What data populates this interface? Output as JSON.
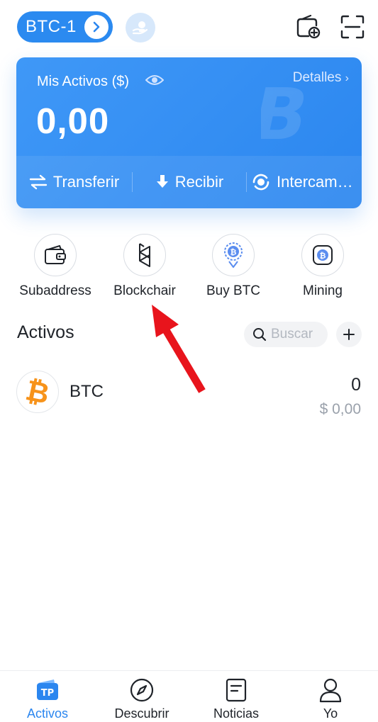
{
  "header": {
    "wallet_name": "BTC-1"
  },
  "card": {
    "label": "Mis Activos ($)",
    "details": "Detalles",
    "amount": "0,00",
    "actions": [
      {
        "label": "Transferir",
        "icon": "transfer-icon"
      },
      {
        "label": "Recibir",
        "icon": "download-icon"
      },
      {
        "label": "Intercam…",
        "icon": "swap-icon"
      }
    ]
  },
  "quick": [
    {
      "label": "Subaddress",
      "icon": "wallet-icon"
    },
    {
      "label": "Blockchair",
      "icon": "blockchair-icon"
    },
    {
      "label": "Buy BTC",
      "icon": "bitcoin-pin-icon"
    },
    {
      "label": "Mining",
      "icon": "mining-icon"
    }
  ],
  "assets": {
    "title": "Activos",
    "search_placeholder": "Buscar",
    "tokens": [
      {
        "symbol": "BTC",
        "balance": "0",
        "value": "$ 0,00"
      }
    ]
  },
  "bottom_nav": [
    {
      "label": "Activos",
      "icon": "tp-wallet-icon",
      "active": true
    },
    {
      "label": "Descubrir",
      "icon": "compass-icon",
      "active": false
    },
    {
      "label": "Noticias",
      "icon": "news-icon",
      "active": false
    },
    {
      "label": "Yo",
      "icon": "user-icon",
      "active": false
    }
  ],
  "colors": {
    "accent": "#2b86ef",
    "annotation": "#e8141c",
    "btc": "#f7931a"
  }
}
